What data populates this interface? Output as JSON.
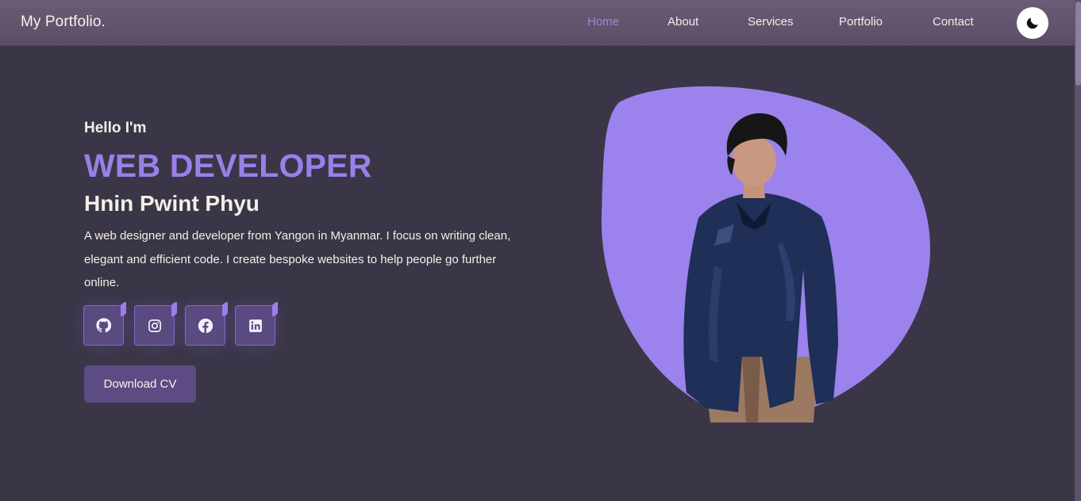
{
  "header": {
    "logo": "My Portfolio.",
    "nav": [
      {
        "label": "Home",
        "active": true
      },
      {
        "label": "About",
        "active": false
      },
      {
        "label": "Services",
        "active": false
      },
      {
        "label": "Portfolio",
        "active": false
      },
      {
        "label": "Contact",
        "active": false
      }
    ],
    "theme_toggle_icon": "moon-icon"
  },
  "hero": {
    "greeting": "Hello I'm",
    "role": "WEB DEVELOPER",
    "name": "Hnin Pwint Phyu",
    "bio": "A web designer and developer from Yangon in Myanmar. I focus on writing clean, elegant and efficient code. I create bespoke websites to help people go further online.",
    "socials": [
      {
        "icon": "github-icon"
      },
      {
        "icon": "instagram-icon"
      },
      {
        "icon": "facebook-icon"
      },
      {
        "icon": "linkedin-icon"
      }
    ],
    "cv_button": "Download CV",
    "image": "portrait-photo"
  },
  "colors": {
    "background": "#3a3647",
    "header": "#5f5269",
    "accent": "#9b7fe8",
    "button": "#5d4b83",
    "blob": "#9b82ec"
  }
}
